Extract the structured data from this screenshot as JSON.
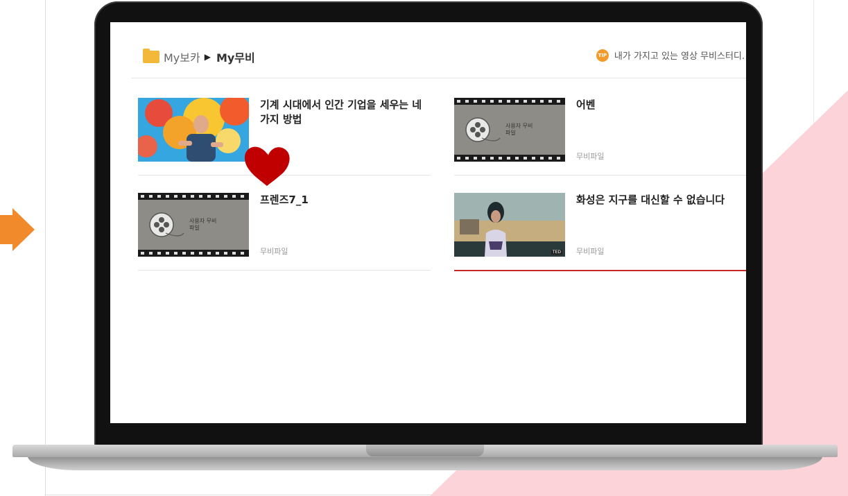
{
  "breadcrumb": {
    "root": "My보카",
    "current": "My무비"
  },
  "tip": {
    "icon_text": "TIP",
    "text": "내가 가지고 있는 영상 무비스터디."
  },
  "videos": [
    {
      "title": "기계 시대에서 인간 기업을 세우는 네 가지 방법",
      "kind": "무비파일",
      "thumb": "person-on-stage"
    },
    {
      "title": "어벤",
      "kind": "무비파일",
      "thumb": "film-reel",
      "thumb_text": "사용자 무비파일"
    },
    {
      "title": "프렌즈7_1",
      "kind": "무비파일",
      "thumb": "film-reel",
      "thumb_text": "사용자 무비파일"
    },
    {
      "title": "화성은 지구를 대신할 수 없습니다",
      "kind": "무비파일",
      "thumb": "speaker-on-stage",
      "thumb_badge": "TED"
    }
  ],
  "colors": {
    "accent": "#c62828",
    "folder": "#f3b73a",
    "arrow": "#f08a2a",
    "heart": "#c00000",
    "pink": "#fbd3d9"
  }
}
